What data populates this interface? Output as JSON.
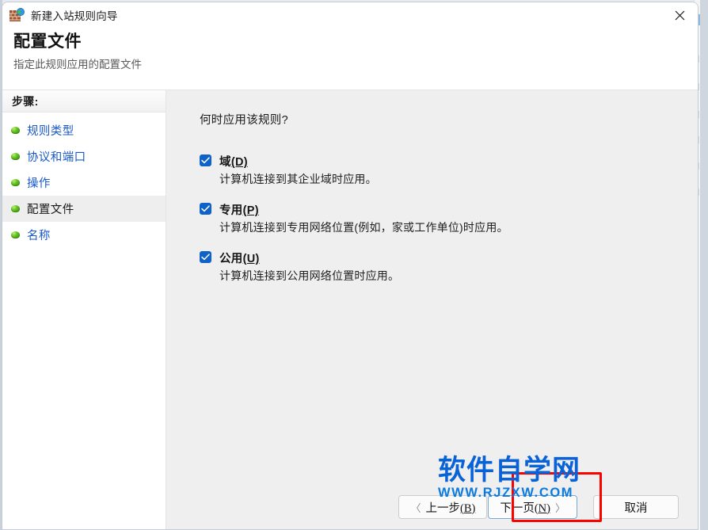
{
  "window": {
    "title": "新建入站规则向导",
    "icon": "firewall-globe-icon",
    "close_label": "✕"
  },
  "header": {
    "title": "配置文件",
    "subtitle": "指定此规则应用的配置文件"
  },
  "sidebar": {
    "heading": "步骤:",
    "items": [
      {
        "label": "规则类型",
        "active": false
      },
      {
        "label": "协议和端口",
        "active": false
      },
      {
        "label": "操作",
        "active": false
      },
      {
        "label": "配置文件",
        "active": true
      },
      {
        "label": "名称",
        "active": false
      }
    ]
  },
  "main": {
    "question": "何时应用该规则?",
    "options": [
      {
        "label": "域",
        "accel": "(D)",
        "checked": true,
        "description": "计算机连接到其企业域时应用。"
      },
      {
        "label": "专用",
        "accel": "(P)",
        "checked": true,
        "description": "计算机连接到专用网络位置(例如，家或工作单位)时应用。"
      },
      {
        "label": "公用",
        "accel": "(U)",
        "checked": true,
        "description": "计算机连接到公用网络位置时应用。"
      }
    ]
  },
  "footer": {
    "back": {
      "chevron": "〈",
      "text": "上一步",
      "accel": "(B)"
    },
    "next": {
      "text": "下一页",
      "accel": "(N)",
      "chevron": "〉",
      "focused": true
    },
    "cancel": {
      "text": "取消"
    }
  },
  "annotation": {
    "color": "#ff0000",
    "target": "next-button"
  },
  "watermark": {
    "main": "软件自学网",
    "sub": "WWW.RJZXW.COM",
    "color": "#0a63d6"
  }
}
